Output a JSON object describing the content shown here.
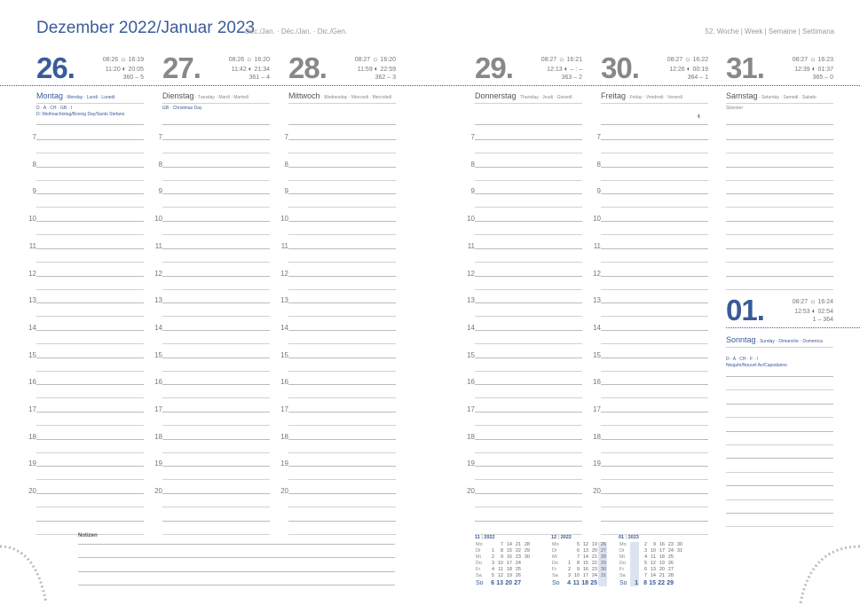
{
  "header": {
    "title": "Dezember 2022/Januar 2023",
    "subtitle": "Dec./Jan. · Déc./Jan. · Dic./Gen.",
    "week": "52. Woche | Week | Semaine | Settimana"
  },
  "days": [
    {
      "num": "26.",
      "sunrise": "08:26",
      "sunset": "16:19",
      "moonrise": "11:20",
      "moonset": "20:05",
      "index": "360 – 5",
      "name": "Montag",
      "trans": " · Monday · Lundi · Lunedì",
      "hol1": "D · A · CH · GB · I",
      "hol2": "D: Weihnachtstag/Boxing Day/Santo Stefano"
    },
    {
      "num": "27.",
      "sunrise": "08:26",
      "sunset": "16:20",
      "moonrise": "11:42",
      "moonset": "21:34",
      "index": "361 – 4",
      "name": "Dienstag",
      "trans": " · Tuesday · Mardi · Martedì",
      "hol1": "GB · Christmas Day",
      "hol2": ""
    },
    {
      "num": "28.",
      "sunrise": "08:27",
      "sunset": "16:20",
      "moonrise": "11:59",
      "moonset": "22:59",
      "index": "362 – 3",
      "name": "Mittwoch",
      "trans": " · Wednesday · Mercredi · Mercoledì",
      "hol1": "",
      "hol2": ""
    },
    {
      "num": "29.",
      "sunrise": "08:27",
      "sunset": "16:21",
      "moonrise": "12:13",
      "moonset": "– : –",
      "index": "363 – 2",
      "name": "Donnerstag",
      "trans": " · Thursday · Jeudi · Giovedì",
      "hol1": "",
      "hol2": ""
    },
    {
      "num": "30.",
      "sunrise": "08:27",
      "sunset": "16:22",
      "moonrise": "12:26",
      "moonset": "00:19",
      "index": "364 – 1",
      "name": "Freitag",
      "trans": " · Friday · Vendredi · Venerdì",
      "hol1": "",
      "hol2": ""
    },
    {
      "num": "31.",
      "sunrise": "08:27",
      "sunset": "16:23",
      "moonrise": "12:39",
      "moonset": "01:37",
      "index": "365 – 0",
      "name": "Samstag",
      "trans": " · Saturday · Samedi · Sabato",
      "hol1": "Silvester",
      "hol2": ""
    }
  ],
  "sunday": {
    "num": "01.",
    "sunrise": "08:27",
    "sunset": "16:24",
    "moonrise": "12:53",
    "moonset": "02:54",
    "index": "1 – 364",
    "name": "Sonntag",
    "trans": " · Sunday · Dimanche · Domenica",
    "hol1": "D · A · CH · F · I",
    "hol2": "Neujahr/Nouvel An/Capodanno"
  },
  "hours": [
    "7",
    "8",
    "9",
    "10",
    "11",
    "12",
    "13",
    "14",
    "15",
    "16",
    "17",
    "18",
    "19",
    "20"
  ],
  "hours_fri": [
    "7",
    "8",
    "9",
    "10",
    "11",
    "12",
    "13",
    "14",
    "15",
    "16",
    "17",
    "18",
    "19",
    "20"
  ],
  "notes_label": "Notizen",
  "calendars": [
    {
      "title": "11",
      "year": "2022",
      "rows": [
        {
          "d": "Mo",
          "v": [
            "",
            "7",
            "14",
            "21",
            "28"
          ]
        },
        {
          "d": "Di",
          "v": [
            "1",
            "8",
            "15",
            "22",
            "29"
          ]
        },
        {
          "d": "Mi",
          "v": [
            "2",
            "9",
            "16",
            "23",
            "30"
          ]
        },
        {
          "d": "Do",
          "v": [
            "3",
            "10",
            "17",
            "24",
            ""
          ]
        },
        {
          "d": "Fr",
          "v": [
            "4",
            "11",
            "18",
            "25",
            ""
          ]
        },
        {
          "d": "Sa",
          "v": [
            "5",
            "12",
            "19",
            "26",
            ""
          ]
        },
        {
          "d": "So",
          "v": [
            "6",
            "13",
            "20",
            "27",
            ""
          ]
        }
      ]
    },
    {
      "title": "12",
      "year": "2022",
      "rows": [
        {
          "d": "Mo",
          "v": [
            "",
            "5",
            "12",
            "19",
            "26"
          ]
        },
        {
          "d": "Di",
          "v": [
            "",
            "6",
            "13",
            "20",
            "27"
          ]
        },
        {
          "d": "Mi",
          "v": [
            "",
            "7",
            "14",
            "21",
            "28"
          ]
        },
        {
          "d": "Do",
          "v": [
            "1",
            "8",
            "15",
            "22",
            "29"
          ]
        },
        {
          "d": "Fr",
          "v": [
            "2",
            "9",
            "16",
            "23",
            "30"
          ]
        },
        {
          "d": "Sa",
          "v": [
            "3",
            "10",
            "17",
            "24",
            "31"
          ]
        },
        {
          "d": "So",
          "v": [
            "4",
            "11",
            "18",
            "25",
            ""
          ]
        }
      ]
    },
    {
      "title": "01",
      "year": "2023",
      "rows": [
        {
          "d": "Mo",
          "v": [
            "",
            "2",
            "9",
            "16",
            "23",
            "30"
          ]
        },
        {
          "d": "Di",
          "v": [
            "",
            "3",
            "10",
            "17",
            "24",
            "31"
          ]
        },
        {
          "d": "Mi",
          "v": [
            "",
            "4",
            "11",
            "18",
            "25",
            ""
          ]
        },
        {
          "d": "Do",
          "v": [
            "",
            "5",
            "12",
            "19",
            "26",
            ""
          ]
        },
        {
          "d": "Fr",
          "v": [
            "",
            "6",
            "13",
            "20",
            "27",
            ""
          ]
        },
        {
          "d": "Sa",
          "v": [
            "",
            "7",
            "14",
            "21",
            "28",
            ""
          ]
        },
        {
          "d": "So",
          "v": [
            "1",
            "8",
            "15",
            "22",
            "29",
            ""
          ]
        }
      ]
    }
  ]
}
